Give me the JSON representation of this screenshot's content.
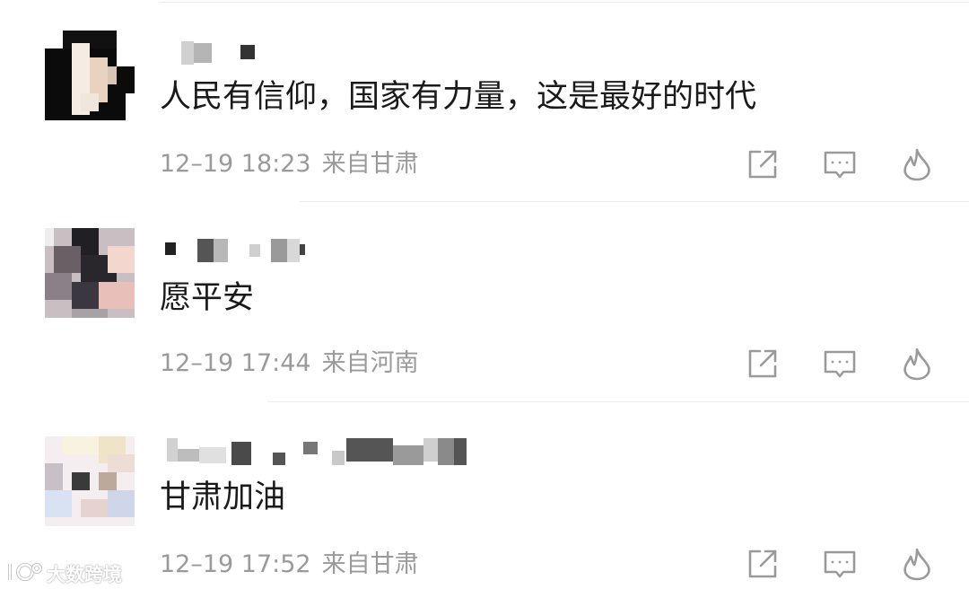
{
  "comments": [
    {
      "text": "人民有信仰，国家有力量，这是最好的时代",
      "time": "12–19 18:23",
      "location": "来自甘肃"
    },
    {
      "text": "愿平安",
      "time": "12–19 17:44",
      "location": "来自河南"
    },
    {
      "text": "甘肃加油",
      "time": "12–19 17:52",
      "location": "来自甘肃"
    }
  ],
  "actions": {
    "share_icon": "share-icon",
    "reply_icon": "reply-icon",
    "like_icon": "flame-icon"
  },
  "watermark": {
    "text": "大数跨境"
  },
  "colors": {
    "text": "#1a1a1a",
    "meta": "#9a9a9a",
    "icon": "#9a9a9a",
    "separator": "#ececec"
  }
}
